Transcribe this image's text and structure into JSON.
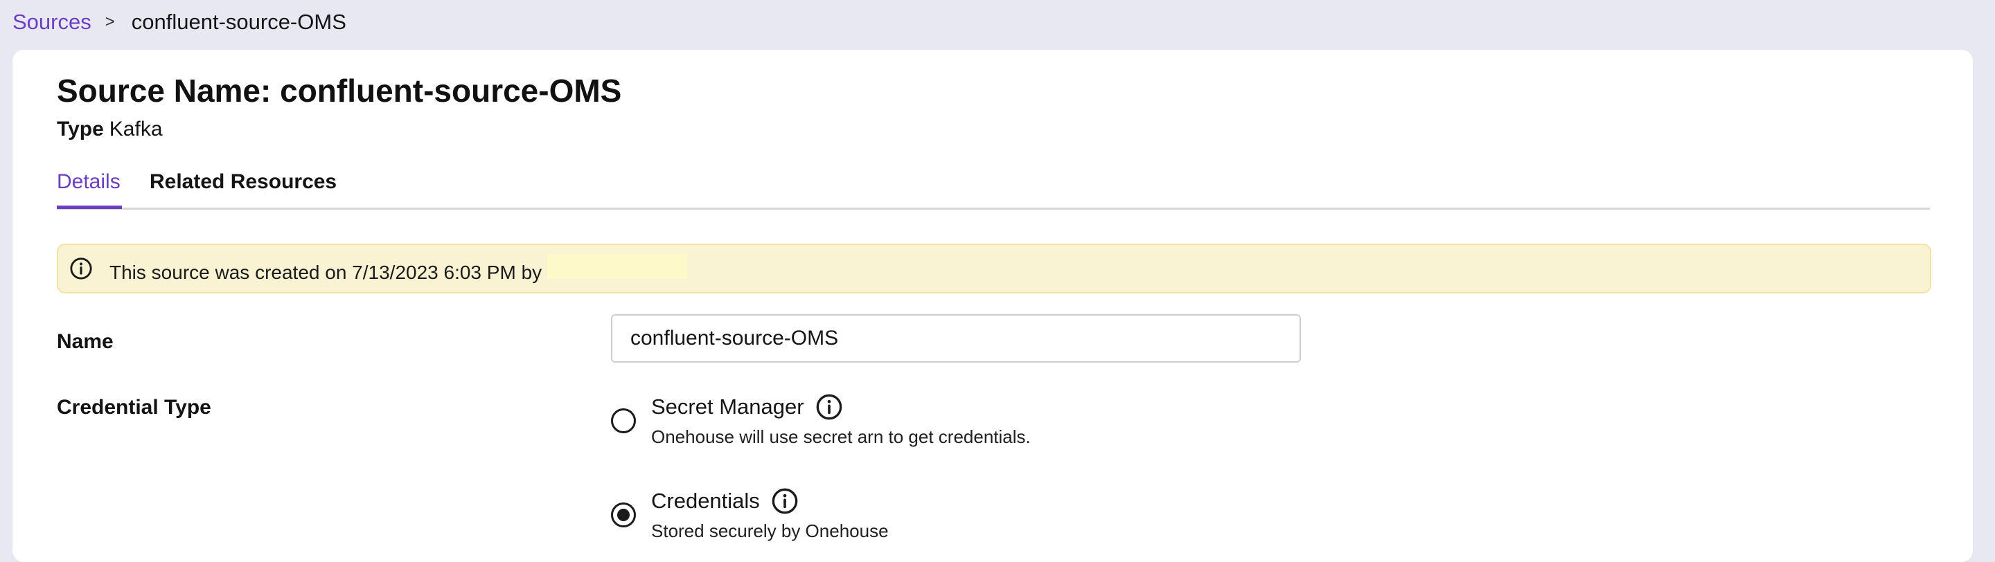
{
  "breadcrumb": {
    "parent": "Sources",
    "separator": ">",
    "current": "confluent-source-OMS"
  },
  "header": {
    "title": "Source Name: confluent-source-OMS",
    "type_label": "Type",
    "type_value": "Kafka"
  },
  "tabs": [
    {
      "label": "Details",
      "active": true
    },
    {
      "label": "Related Resources",
      "active": false
    }
  ],
  "notice": {
    "icon": "info-circle-icon",
    "text": "This source was created on 7/13/2023 6:03 PM by"
  },
  "form": {
    "name_label": "Name",
    "name_value": "confluent-source-OMS",
    "credential_type_label": "Credential Type",
    "credential_options": [
      {
        "title": "Secret Manager",
        "description": "Onehouse will use secret arn to get credentials.",
        "selected": false
      },
      {
        "title": "Credentials",
        "description": "Stored securely by Onehouse",
        "selected": true
      }
    ]
  },
  "colors": {
    "accent": "#6b3fc4",
    "background": "#e8e8f2",
    "notice_bg": "#faf3d3"
  }
}
